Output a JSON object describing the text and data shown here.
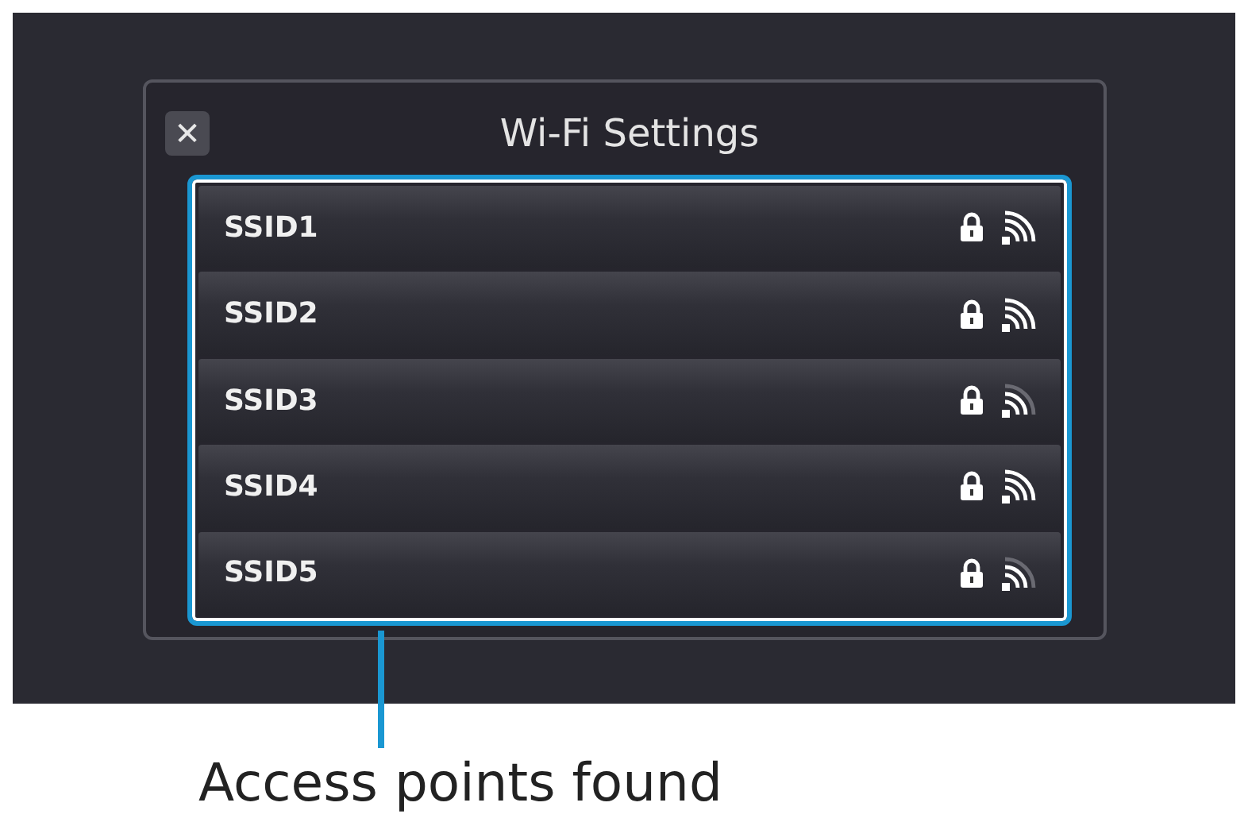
{
  "dialog": {
    "close_label": "✕",
    "title": "Wi-Fi Settings"
  },
  "networks": [
    {
      "ssid": "SSID1",
      "locked": true,
      "strong": true
    },
    {
      "ssid": "SSID2",
      "locked": true,
      "strong": true
    },
    {
      "ssid": "SSID3",
      "locked": true,
      "strong": false
    },
    {
      "ssid": "SSID4",
      "locked": true,
      "strong": true
    },
    {
      "ssid": "SSID5",
      "locked": true,
      "strong": false
    }
  ],
  "callout": {
    "label": "Access points found"
  }
}
